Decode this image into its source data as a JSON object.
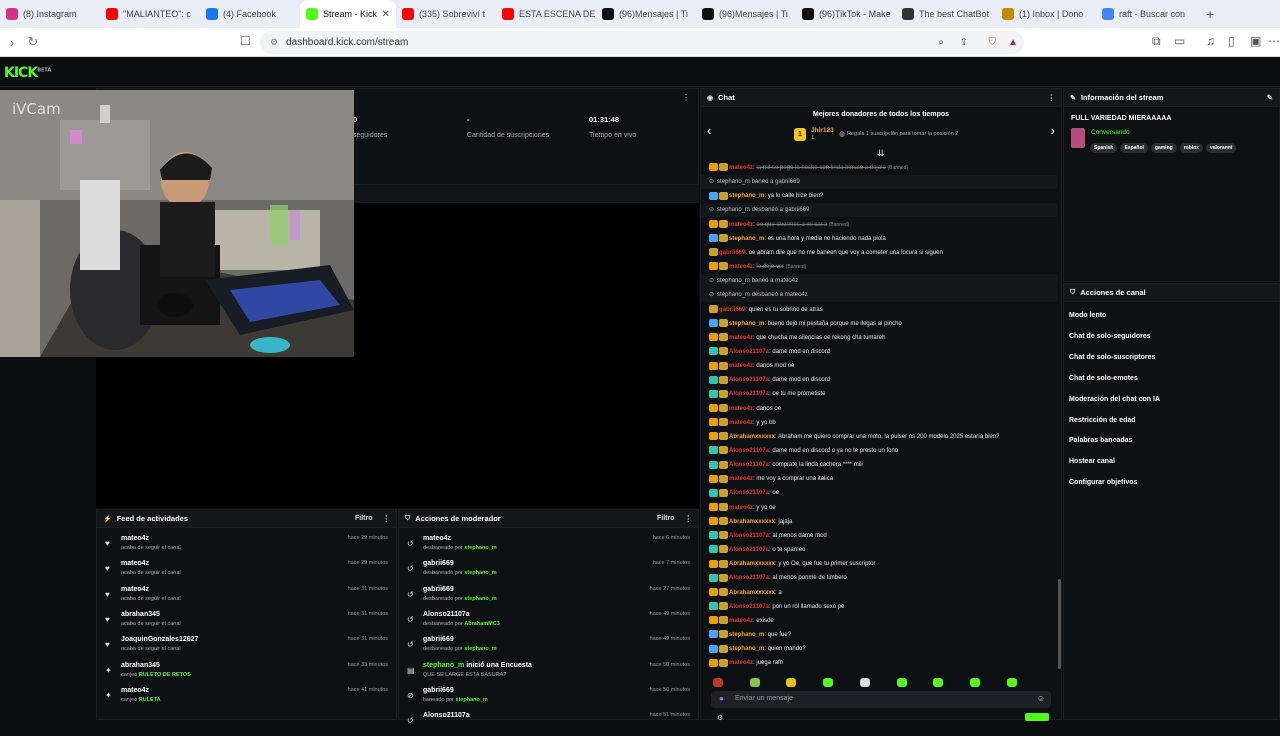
{
  "browser": {
    "tabs": [
      {
        "label": "(8) Instagram",
        "color": "#d63384"
      },
      {
        "label": "\"MALIANTEO\": c",
        "color": "#ff0000"
      },
      {
        "label": "(4) Facebook",
        "color": "#1877f2"
      },
      {
        "label": "Stream - Kick",
        "color": "#53fc18",
        "active": true
      },
      {
        "label": "(335) Sobreviví t",
        "color": "#ff0000"
      },
      {
        "label": "ESTA ESCENA DE",
        "color": "#ff0000"
      },
      {
        "label": "(96)Mensajes | Ti",
        "color": "#111111"
      },
      {
        "label": "(96)Mensajes | Ti",
        "color": "#111111"
      },
      {
        "label": "(96)TikTok - Make",
        "color": "#111111"
      },
      {
        "label": "The best ChatBot",
        "color": "#333333"
      },
      {
        "label": "(1) Inbox | Dono",
        "color": "#c28a00"
      },
      {
        "label": "raft - Buscar con",
        "color": "#4285f4"
      }
    ],
    "url": "dashboard.kick.com/stream"
  },
  "brand": {
    "logo": "KICK",
    "sup": "BETA"
  },
  "stats": {
    "followers_value": "0",
    "followers_label": "seguidores",
    "subs_value": "-",
    "subs_label": "Cantidad de suscripciones",
    "time_value": "01:31:48",
    "time_label": "Tiempo en vivo"
  },
  "cam_label": "iVCam",
  "activity_feed": {
    "title": "Feed de actividades",
    "filter": "Filtro",
    "items": [
      {
        "user": "mateo4z",
        "action": "acaba de seguir el canal",
        "time": "hace 29 minutos",
        "icon": "♥"
      },
      {
        "user": "mateo4z",
        "action": "acaba de seguir el canal",
        "time": "hace 29 minutos",
        "icon": "♥"
      },
      {
        "user": "mateo4z",
        "action": "acaba de seguir el canal",
        "time": "hace 31 minutos",
        "icon": "♥"
      },
      {
        "user": "abrahan345",
        "action": "acaba de seguir el canal",
        "time": "hace 31 minutos",
        "icon": "♥"
      },
      {
        "user": "JoaquinGonzales12627",
        "action": "acaba de seguir el canal",
        "time": "hace 31 minutos",
        "icon": "♥"
      },
      {
        "user": "abrahan345",
        "action": "canjeó",
        "highlight": "RULETO DE RETOS",
        "time": "hace 33 minutos",
        "icon": "✦"
      },
      {
        "user": "mateo4z",
        "action": "canjeó",
        "highlight": "RULETA",
        "time": "hace 41 minutos",
        "icon": "✦"
      }
    ]
  },
  "mod_actions": {
    "title": "Acciones de moderador",
    "filter": "Filtro",
    "items": [
      {
        "user": "mateo4z",
        "action": "desbaneado por",
        "by": "stephano_m",
        "time": "hace 6 minutos",
        "icon": "↺"
      },
      {
        "user": "gabrii669",
        "action": "desbaneado por",
        "by": "stephano_m",
        "time": "hace 7 minutos",
        "icon": "↺"
      },
      {
        "user": "gabrii669",
        "action": "desbaneado por",
        "by": "stephano_m",
        "time": "hace 27 minutos",
        "icon": "↺"
      },
      {
        "user": "Alonso21107a",
        "action": "desbaneado por",
        "by": "AbrahamMC3",
        "time": "hace 49 minutos",
        "icon": "↺"
      },
      {
        "user": "gabrii669",
        "action": "desbaneado por",
        "by": "stephano_m",
        "time": "hace 49 minutos",
        "icon": "↺"
      },
      {
        "user": "stephano_m",
        "action": "QUE SE LARGE ESTA BASURA?",
        "by": "",
        "title_suffix": "inició una Encuesta",
        "time": "hace 50 minutos",
        "icon": "▤"
      },
      {
        "user": "gabrii669",
        "action": "baneado por",
        "by": "stephano_m",
        "time": "hace 50 minutos",
        "icon": "⊘"
      },
      {
        "user": "Alonso21107a",
        "action": "",
        "by": "",
        "time": "hace 51 minutos",
        "icon": "↺"
      }
    ]
  },
  "chat": {
    "title": "Chat",
    "top_donors_title": "Mejores donadores de todos los tiempos",
    "top_donor_name": "Jhir123",
    "top_donor_amount": "1",
    "top_donor_cta": "Regala 1 suscripción para tomar la posición 2",
    "input_placeholder": "Enviar un mensaje",
    "messages": [
      {
        "user": "mateo4z",
        "color": "#e3342f",
        "text": "la mil se pego la noche con linda bimato a dejalo",
        "deleted": true,
        "badge": "#e8a000"
      },
      {
        "system": true,
        "text": "stephano_m baneó a gabrii669"
      },
      {
        "user": "stephano_m",
        "color": "#f5a623",
        "text": "ya lo calle hize bien?",
        "badge": "#4aa3ff"
      },
      {
        "system": true,
        "text": "stephano_m desbaneó a gabrii669"
      },
      {
        "user": "mateo4z",
        "color": "#e3342f",
        "text": "oe que duermes a mi casa",
        "deleted": true,
        "badge": "#e8a000"
      },
      {
        "user": "stephano_m",
        "color": "#f5a623",
        "text": "es una hora y media no haciendo nada piola",
        "badge": "#4aa3ff"
      },
      {
        "user": "gabrii669",
        "color": "#e3342f",
        "text": "oe abram dile que no me baneen que voy a cometer una locura si siguen"
      },
      {
        "user": "mateo4z",
        "color": "#e3342f",
        "text": "le dejo ver",
        "deleted": true,
        "badge": "#e8a000"
      },
      {
        "system": true,
        "text": "stephano_m baneó a mateo4z"
      },
      {
        "system": true,
        "text": "stephano_m desbaneó a mateo4z"
      },
      {
        "user": "gabrii669",
        "color": "#e3342f",
        "text": "quien es tu sobrino de atras"
      },
      {
        "user": "stephano_m",
        "color": "#f5a623",
        "text": "bueno dejo mi pestaña porque me llegas al pincho",
        "badge": "#4aa3ff"
      },
      {
        "user": "mateo4z",
        "color": "#e3342f",
        "text": "que chucha me silencias oe rekong cha tumareh",
        "badge": "#e8a000"
      },
      {
        "user": "Alonso21107a",
        "color": "#e3342f",
        "text": "dame mod en discord",
        "badge": "#2ec4b6"
      },
      {
        "user": "mateo4z",
        "color": "#e3342f",
        "text": "danos mod oe",
        "badge": "#e8a000"
      },
      {
        "user": "Alonso21107a",
        "color": "#e3342f",
        "text": "dame mod en discord",
        "badge": "#2ec4b6"
      },
      {
        "user": "Alonso21107a",
        "color": "#e3342f",
        "text": "oe tu me prometiste",
        "badge": "#2ec4b6"
      },
      {
        "user": "mateo4z",
        "color": "#e3342f",
        "text": "danos oe",
        "badge": "#e8a000"
      },
      {
        "user": "mateo4z",
        "color": "#e3342f",
        "text": "y yo bb",
        "badge": "#e8a000"
      },
      {
        "user": "Abrahamxxxxxx",
        "color": "#f5a623",
        "text": "Abraham me quiero comprar una moto, la pulser ns 200 modelo 2025 estaría bien?",
        "badge": "#e8a000"
      },
      {
        "user": "Alonso21107a",
        "color": "#e3342f",
        "text": "dame mod en discord o ya no te presto un fono",
        "badge": "#2ec4b6"
      },
      {
        "user": "Alonso21107a",
        "color": "#e3342f",
        "text": "comprate la linda cachera **** mili",
        "badge": "#2ec4b6"
      },
      {
        "user": "mateo4z",
        "color": "#e3342f",
        "text": "me voy a comprar una italica",
        "badge": "#e8a000"
      },
      {
        "user": "Alonso21107a",
        "color": "#e3342f",
        "text": "oe",
        "badge": "#2ec4b6"
      },
      {
        "user": "mateo4z",
        "color": "#e3342f",
        "text": "y yo oe",
        "badge": "#e8a000"
      },
      {
        "user": "Abrahamxxxxxx",
        "color": "#f5a623",
        "text": "jajaja",
        "badge": "#e8a000"
      },
      {
        "user": "Alonso21107a",
        "color": "#e3342f",
        "text": "al menos dame mod",
        "badge": "#2ec4b6"
      },
      {
        "user": "Alonso21107a",
        "color": "#e3342f",
        "text": "o te spameo",
        "badge": "#2ec4b6"
      },
      {
        "user": "Abrahamxxxxxx",
        "color": "#f5a623",
        "text": "y yo Oe, que fue tu primer suscriptor",
        "badge": "#e8a000"
      },
      {
        "user": "Alonso21107a",
        "color": "#e3342f",
        "text": "al menos ponme de timbero",
        "badge": "#2ec4b6"
      },
      {
        "user": "Abrahamxxxxxx",
        "color": "#f5a623",
        "text": "a",
        "badge": "#e8a000"
      },
      {
        "user": "Alonso21107a",
        "color": "#e3342f",
        "text": "pon un rol llamado sexo pe",
        "badge": "#2ec4b6"
      },
      {
        "user": "mateo4z",
        "color": "#e3342f",
        "text": "exisde",
        "badge": "#e8a000"
      },
      {
        "user": "stephano_m",
        "color": "#f5a623",
        "text": "que fue?",
        "badge": "#4aa3ff"
      },
      {
        "user": "stephano_m",
        "color": "#f5a623",
        "text": "quien mando?",
        "badge": "#4aa3ff"
      },
      {
        "user": "mateo4z",
        "color": "#e3342f",
        "text": "juega rafh",
        "badge": "#e8a000"
      }
    ],
    "banned_label": "(Banned)"
  },
  "stream_info": {
    "title": "Información del stream",
    "stream_title": "FULL VARIEDAD MIERAAAAA",
    "category": "Conversando",
    "tags": [
      "Spanish",
      "Español",
      "gaming",
      "roblox",
      "valorannt"
    ]
  },
  "channel_actions": {
    "title": "Acciones de canal",
    "items": [
      "Modo lento",
      "Chat de solo-seguidores",
      "Chat de solo-suscriptores",
      "Chat de solo-emotes",
      "Moderación del chat con IA",
      "Restricción de edad",
      "Palabras baneadas",
      "Hostear canal",
      "Configurar objetivos"
    ]
  }
}
